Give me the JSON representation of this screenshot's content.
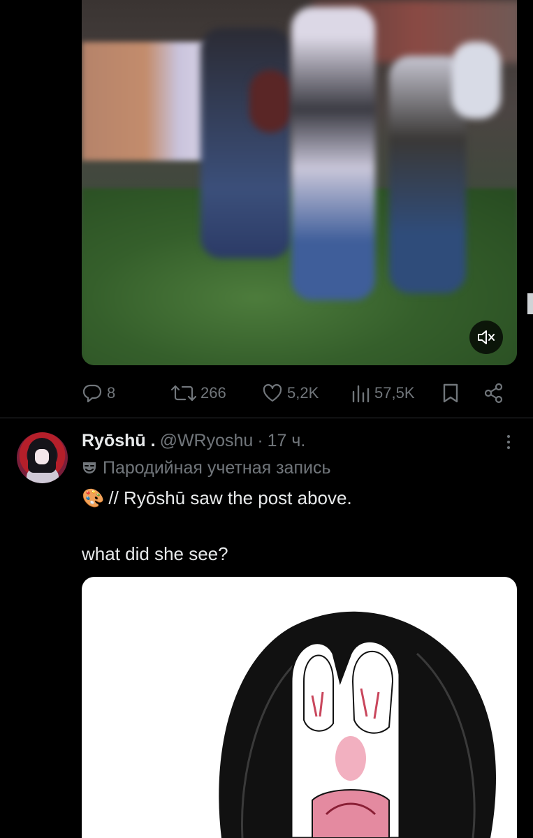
{
  "video": {
    "mute_icon": "speaker-muted-icon"
  },
  "actions": {
    "reply": {
      "icon": "reply-icon",
      "count": "8"
    },
    "retweet": {
      "icon": "retweet-icon",
      "count": "266"
    },
    "like": {
      "icon": "heart-icon",
      "count": "5,2K"
    },
    "views": {
      "icon": "views-bar-chart-icon",
      "count": "57,5K"
    },
    "bookmark": {
      "icon": "bookmark-icon"
    },
    "share": {
      "icon": "share-icon"
    }
  },
  "post": {
    "display_name": "Ryōshū .",
    "handle": "@WRyoshu",
    "separator": "·",
    "time": "17 ч.",
    "parody_label": "Пародийная учетная запись",
    "text_line_1": "// Ryōshū saw the post above.",
    "text_emoji": "🎨",
    "text_line_2": "what did she see?"
  },
  "colors": {
    "background": "#000000",
    "text_primary": "#e7e9ea",
    "text_secondary": "#71767b",
    "divider": "#2f3336"
  }
}
